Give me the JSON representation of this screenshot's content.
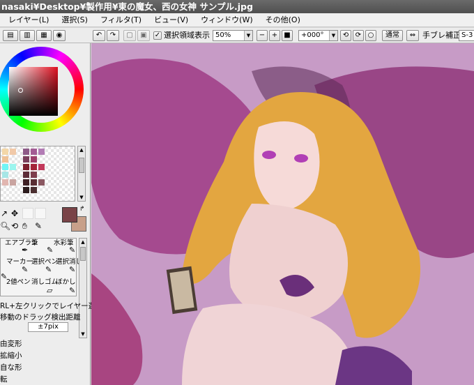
{
  "window": {
    "title": "nasaki¥Desktop¥製作用¥東の魔女、西の女神  サンプル.jpg"
  },
  "menu": [
    "レイヤー(L)",
    "選択(S)",
    "フィルタ(T)",
    "ビュー(V)",
    "ウィンドウ(W)",
    "その他(O)"
  ],
  "toolbar": {
    "selection_checkbox_label": "選択領域表示",
    "selection_checked": true,
    "zoom_value": "50%",
    "rotation_value": "+000°",
    "blend_mode": "通常",
    "stabilizer_label": "手ブレ補正",
    "stabilizer_value": "S-3"
  },
  "colors": {
    "primary": "#7a4448",
    "secondary": "#c8a08a",
    "canvas_bg": "#c79bc6",
    "title_bg": "#5a5a5a"
  },
  "tools": {
    "labels": [
      "エアブラシ",
      "筆",
      "水彩筆",
      "マーカー",
      "選択ペン",
      "選択消し",
      "2値ペン",
      "消しゴム",
      "ぼかし"
    ]
  },
  "options": {
    "hint": "RL+左クリックでレイヤー選択",
    "drag_label": "移動のドラッグ検出距離",
    "drag_value": "±7pix",
    "items": [
      "由変形",
      "拡縮小",
      "自な形",
      "転"
    ]
  }
}
